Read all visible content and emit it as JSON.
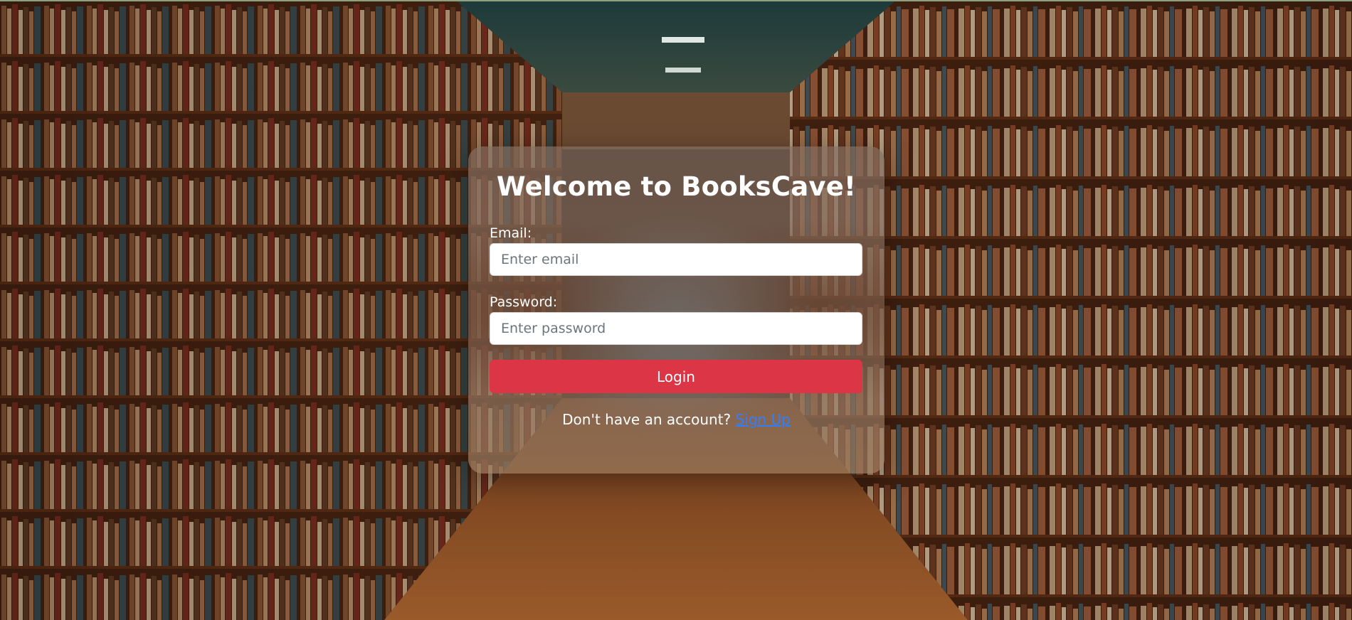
{
  "page": {
    "background_image": "library-bookshelves-aisle"
  },
  "login": {
    "title": "Welcome to BooksCave!",
    "email_label": "Email:",
    "email_placeholder": "Enter email",
    "email_value": "",
    "password_label": "Password:",
    "password_placeholder": "Enter password",
    "password_value": "",
    "submit_label": "Login",
    "signup_prompt": "Don't have an account?",
    "signup_link": "Sign Up"
  },
  "colors": {
    "button": "#dc3545",
    "link": "#2f7fff",
    "text": "#ffffff"
  }
}
